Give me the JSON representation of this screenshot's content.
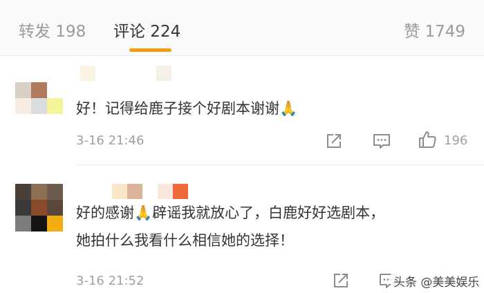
{
  "tabs": {
    "repost_label": "转发 198",
    "comments_label": "评论 224",
    "likes_label": "赞 1749"
  },
  "comments": [
    {
      "text": "好！记得给鹿子接个好剧本谢谢🙏",
      "time": "3-16 21:46",
      "like_count": "196"
    },
    {
      "text_line1": "好的感谢🙏辟谣我就放心了，白鹿好好选剧本，",
      "text_line2": "她拍什么我看什么相信她的选择！",
      "time": "3-16 21:52"
    }
  ],
  "watermark": "头条 @美美娱乐",
  "colors": {
    "accent": "#f39c12",
    "muted": "#a0a0a0",
    "text": "#333333"
  }
}
